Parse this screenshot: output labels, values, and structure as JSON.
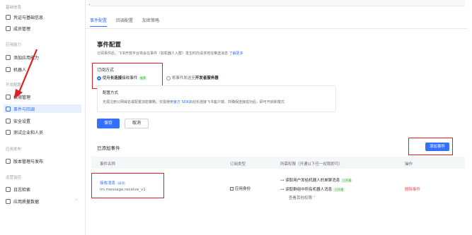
{
  "sidebar": {
    "groups": [
      {
        "label": "基础信息",
        "items": [
          {
            "label": "凭证与基础信息",
            "icon": "credential-icon"
          },
          {
            "label": "成员管理",
            "icon": "member-icon"
          }
        ]
      },
      {
        "label": "应用能力",
        "items": [
          {
            "label": "添加应用能力",
            "icon": "add-ability-icon"
          },
          {
            "label": "机器人",
            "icon": "robot-icon"
          }
        ]
      },
      {
        "label": "开发配置",
        "items": [
          {
            "label": "权限管理",
            "icon": "permission-icon"
          },
          {
            "label": "事件与回调",
            "icon": "event-icon",
            "active": true
          },
          {
            "label": "安全设置",
            "icon": "shield-icon"
          },
          {
            "label": "测试企业和人员",
            "icon": "test-icon"
          }
        ]
      },
      {
        "label": "应用发布",
        "items": [
          {
            "label": "版本管理与发布",
            "icon": "version-icon"
          }
        ]
      },
      {
        "label": "运营监控",
        "items": [
          {
            "label": "日志检索",
            "icon": "log-icon"
          },
          {
            "label": "应用质量数据",
            "icon": "chart-icon"
          }
        ]
      }
    ],
    "collapse_glyph": "«"
  },
  "tabs": [
    {
      "label": "事件配置",
      "active": true
    },
    {
      "label": "回调配置",
      "active": false
    },
    {
      "label": "加密策略",
      "active": false
    }
  ],
  "event_config": {
    "title": "事件配置",
    "description": "订阅事件后，飞书开放平台将会在事件（如机器人入群）发生时向请求地址推送消息",
    "learn_more": "了解更多",
    "subscribe_method_label": "订阅方式",
    "option_long_connection_prefix": "使用",
    "option_long_connection_strong": "长连接",
    "option_long_connection_suffix": "接收事件",
    "option_badge": "推荐",
    "option_webhook_prefix": "将事件发送至",
    "option_webhook_strong": "开发者服务器",
    "config_title": "配置方式",
    "config_desc_prefix": "无需注册公网域名或配置加密策略，仅需使用",
    "config_desc_link": "官方 SDK",
    "config_desc_suffix": "启动长连接飞书客户端，并确保连接成功后，即可开启新模式",
    "save_label": "保存",
    "cancel_label": "取消"
  },
  "added_events": {
    "title": "已添加事件",
    "add_button": "添加事件",
    "columns": [
      "事件名称",
      "订阅类型",
      "所需权限（开通以下任一权限即可）",
      "操作"
    ],
    "row": {
      "name": "接收消息",
      "version_badge": "v2.0",
      "event_key": "im.message.receive_v1",
      "type": "应用身份",
      "permissions": [
        {
          "text": "读取用户发给机器人的单聊消息",
          "badge": "已开通"
        },
        {
          "text": "读取群组中所有机器人消息",
          "badge": "已开通"
        }
      ],
      "more_permissions": "查看其他权限",
      "action": "删除事件"
    }
  },
  "colors": {
    "accent": "#3370ff",
    "annotation": "#e02020",
    "danger": "#f54a45"
  }
}
